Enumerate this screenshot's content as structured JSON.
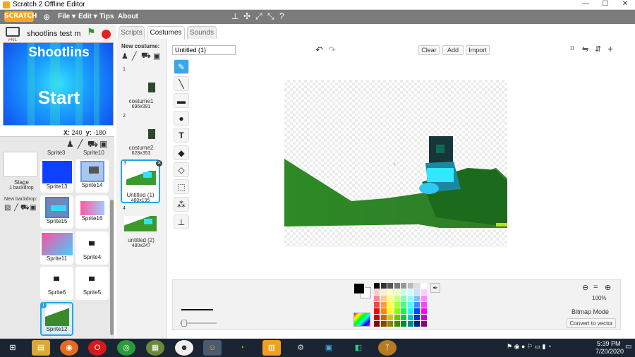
{
  "window": {
    "title": "Scratch 2 Offline Editor",
    "version": "v461"
  },
  "menu": {
    "logo": "SCRATCH",
    "items": [
      "File ▾",
      "Edit ▾",
      "Tips",
      "About"
    ]
  },
  "project": {
    "title": "shootlins test m"
  },
  "stage": {
    "line1": "Shootlins",
    "line2": "Start"
  },
  "coords": {
    "x_label": "X:",
    "x_value": "240",
    "y_label": "y:",
    "y_value": "-180"
  },
  "stage_info": {
    "name": "Stage",
    "backdrops": "1 backdrop",
    "new_backdrop": "New backdrop:"
  },
  "sprites": [
    "Sprite3",
    "Sprite10",
    "Sprite13",
    "Sprite14",
    "Sprite15",
    "Sprite16",
    "Sprite11",
    "Sprite4",
    "Sprite6",
    "Sprite5",
    "Sprite12"
  ],
  "tabs": [
    "Scripts",
    "Costumes",
    "Sounds"
  ],
  "costume_panel": {
    "new_costume": "New costume:"
  },
  "costumes": [
    {
      "num": "1",
      "name": "costume1",
      "size": "696x391"
    },
    {
      "num": "2",
      "name": "costume2",
      "size": "628x353"
    },
    {
      "num": "3",
      "name": "Untitled (1)",
      "size": "480x195"
    },
    {
      "num": "4",
      "name": "untitled (2)",
      "size": "480x247"
    }
  ],
  "editor": {
    "name_value": "Untitled (1)",
    "clear": "Clear",
    "add": "Add",
    "import": "Import",
    "zoom": "100%",
    "mode": "Bitmap Mode",
    "convert": "Convert to vector"
  },
  "taskbar": {
    "time": "5:39 PM",
    "date": "7/20/2020"
  },
  "colors": {
    "menubar": "#7b7b7b",
    "accent": "#25a5e8",
    "selected_costume": "#25a5e8"
  }
}
